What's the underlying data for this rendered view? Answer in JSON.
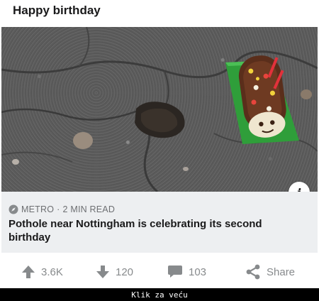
{
  "post": {
    "title": "Happy birthday",
    "image_alt": "Caterpillar cake with candles next to a pothole"
  },
  "link_card": {
    "source": "METRO",
    "separator": "·",
    "read_time": "2 MIN READ",
    "headline": "Pothole near Nottingham is celebrating its second birthday"
  },
  "actions": {
    "upvotes": "3.6K",
    "downvotes": "120",
    "comments": "103",
    "share_label": "Share"
  },
  "footer": {
    "text": "Klik za veću"
  },
  "colors": {
    "icon_gray": "#878a8c",
    "card_bg": "#edeff1",
    "plate_green": "#2f9e3a",
    "cake_brown": "#5a2e1b"
  },
  "icons": {
    "source": "compass-icon",
    "info": "info-icon",
    "upvote": "up-arrow-icon",
    "downvote": "down-arrow-icon",
    "comment": "comment-bubble-icon",
    "share": "share-icon"
  }
}
